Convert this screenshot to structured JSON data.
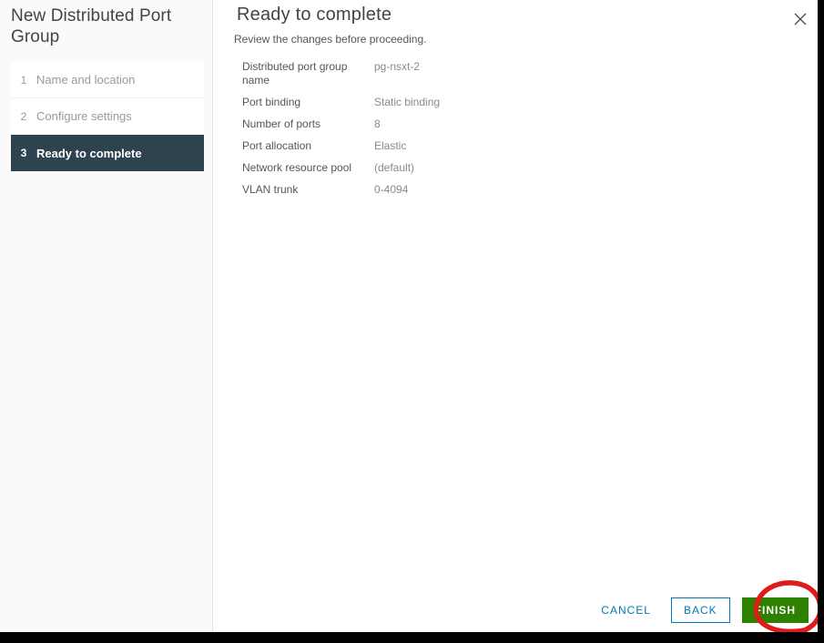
{
  "wizard": {
    "title": "New Distributed Port Group",
    "close_icon": "close-icon"
  },
  "sidebar": {
    "steps": [
      {
        "number": "1",
        "label": "Name and location",
        "state": "completed"
      },
      {
        "number": "2",
        "label": "Configure settings",
        "state": "completed"
      },
      {
        "number": "3",
        "label": "Ready to complete",
        "state": "active"
      }
    ],
    "accent_color": "#60b515",
    "active_bg": "#2d4450"
  },
  "main": {
    "title": "Ready to complete",
    "subtitle": "Review the changes before proceeding.",
    "summary": [
      {
        "label": "Distributed port group name",
        "value": "pg-nsxt-2"
      },
      {
        "label": "Port binding",
        "value": "Static binding"
      },
      {
        "label": "Number of ports",
        "value": "8"
      },
      {
        "label": "Port allocation",
        "value": "Elastic"
      },
      {
        "label": "Network resource pool",
        "value": "(default)"
      },
      {
        "label": "VLAN trunk",
        "value": "0-4094"
      }
    ]
  },
  "footer": {
    "cancel_label": "CANCEL",
    "back_label": "BACK",
    "finish_label": "FINISH",
    "link_color": "#0079b8",
    "finish_color": "#2d8000"
  },
  "annotation": {
    "type": "hand-drawn-circle",
    "target": "finish-button",
    "color": "#e01b1b"
  }
}
